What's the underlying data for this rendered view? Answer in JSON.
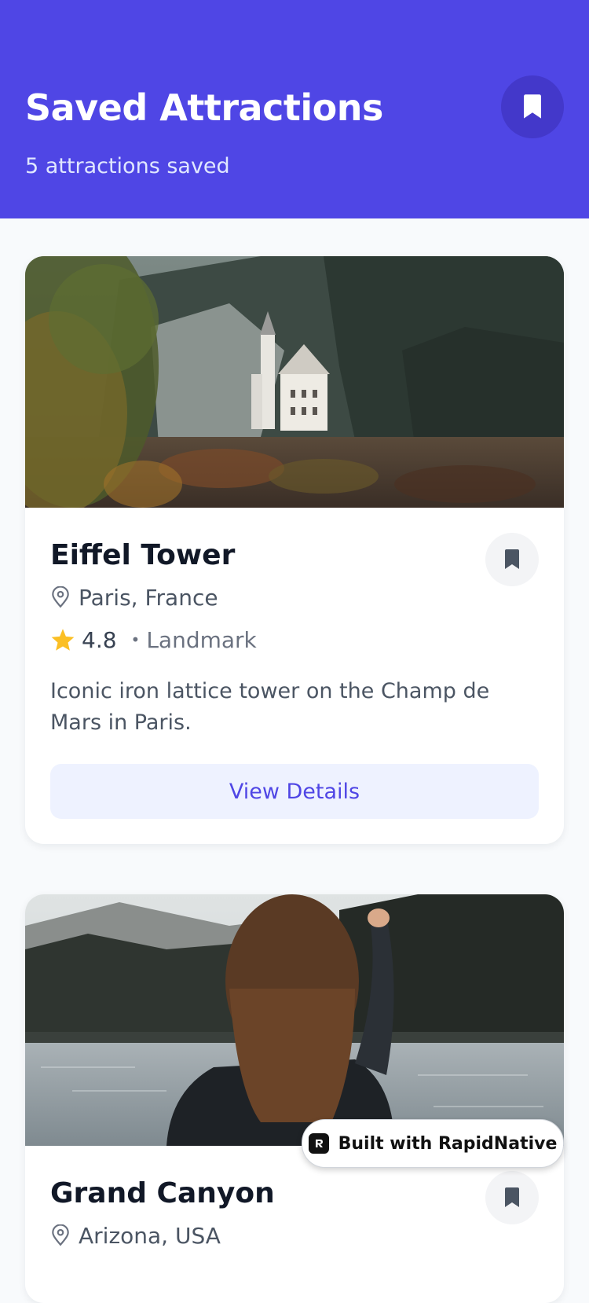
{
  "header": {
    "title": "Saved Attractions",
    "subtitle": "5 attractions saved",
    "bookmark_icon": "bookmark-icon"
  },
  "attractions": [
    {
      "name": "Eiffel Tower",
      "location": "Paris, France",
      "rating": "4.8",
      "separator": "•",
      "category": "Landmark",
      "description": "Iconic iron lattice tower on the Champ de Mars in Paris.",
      "button_label": "View Details",
      "image": "castle-on-forested-mountainside-photo"
    },
    {
      "name": "Grand Canyon",
      "location": "Arizona, USA",
      "image": "person-pointing-at-lake-photo"
    }
  ],
  "badge": {
    "label": "Built with RapidNative"
  },
  "colors": {
    "primary": "#4f46e5",
    "primary_dark": "#4338ca",
    "button_bg": "#eef2ff",
    "star": "#fbbf24",
    "background": "#f8fafc"
  }
}
